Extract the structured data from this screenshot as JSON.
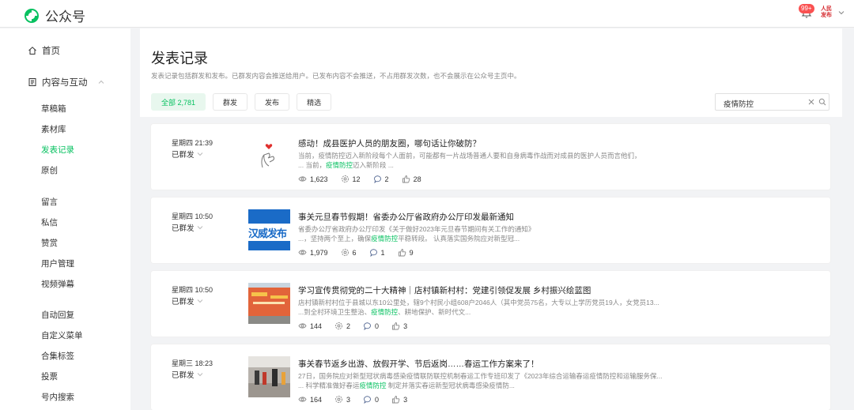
{
  "app": {
    "name": "公众号",
    "badge": "99+",
    "avatar_text": "人民发布"
  },
  "sidebar": {
    "home": "首页",
    "group": "内容与互动",
    "items": [
      {
        "label": "草稿箱"
      },
      {
        "label": "素材库"
      },
      {
        "label": "发表记录",
        "active": true
      },
      {
        "label": "原创"
      },
      {
        "label": "留言"
      },
      {
        "label": "私信"
      },
      {
        "label": "赞赏"
      },
      {
        "label": "用户管理"
      },
      {
        "label": "视频弹幕"
      },
      {
        "label": "自动回复"
      },
      {
        "label": "自定义菜单"
      },
      {
        "label": "合集标签"
      },
      {
        "label": "投票"
      },
      {
        "label": "号内搜索"
      }
    ]
  },
  "page": {
    "title": "发表记录",
    "description": "发表记录包括群发和发布。已群发内容会推送给用户。已发布内容不会推送，不占用群发次数，也不会展示在公众号主页中。",
    "filters": [
      {
        "label": "全部 2,781",
        "active": true
      },
      {
        "label": "群发"
      },
      {
        "label": "发布"
      },
      {
        "label": "精选"
      }
    ],
    "search_value": "疫情防控"
  },
  "articles": [
    {
      "time": "星期四 21:39",
      "status": "已群发",
      "title": "感动！成县医护人员的朋友圈，哪句话让你破防？",
      "summary_line1": "当前，疫情防控迈入新阶段每个人面前，可能都有一片战场普通人要和自身病毒作战而对成县的医护人员而言他们，",
      "summary_pre": "... 当前，",
      "summary_hl": "疫情防控",
      "summary_post": "迈入新阶段 ...",
      "views": "1,623",
      "shares": "12",
      "comments": "2",
      "likes": "28",
      "thumb": "heart"
    },
    {
      "time": "星期四 10:50",
      "status": "已群发",
      "title": "事关元旦春节假期！省委办公厅省政府办公厅印发最新通知",
      "summary_line1": "省委办公厅省政府办公厅印发《关于做好2023年元旦春节期间有关工作的通知》",
      "summary_pre": "...，坚持两个至上，确保",
      "summary_hl": "疫情防控",
      "summary_post": "平稳转段。 认真落实国务院应对新型冠...",
      "views": "1,979",
      "shares": "6",
      "comments": "1",
      "likes": "9",
      "thumb": "banner",
      "thumb_text": "汉威发布"
    },
    {
      "time": "星期四 10:50",
      "status": "已群发",
      "title": "学习宣传贯彻党的二十大精神｜店村镇新村村：党建引领促发展 乡村振兴绘蓝图",
      "summary_line1": "店村镇新村村位于县城以东10公里处，辖9个村民小组608户2046人（其中党员75名，大专以上学历党员19人，女党员13...",
      "summary_pre": "...到全村环境卫生整治、",
      "summary_hl": "疫情防控",
      "summary_post": "、耕地保护、新时代文...",
      "views": "144",
      "shares": "2",
      "comments": "0",
      "likes": "3",
      "thumb": "photo1"
    },
    {
      "time": "星期三 18:23",
      "status": "已群发",
      "title": "事关春节返乡出游、放假开学、节后返岗……春运工作方案来了！",
      "summary_line1": "27日，国务院应对新型冠状病毒感染疫情联防联控机制春运工作专班印发了《2023年综合运输春运疫情防控和运输服务保...",
      "summary_pre": "... 科学精准做好春运",
      "summary_hl": "疫情防控",
      "summary_post": " 制定并落实春运新型冠状病毒感染疫情防...",
      "views": "164",
      "shares": "3",
      "comments": "0",
      "likes": "3",
      "thumb": "photo2"
    }
  ],
  "colors": {
    "accent": "#07c160",
    "badge": "#fa5151"
  }
}
